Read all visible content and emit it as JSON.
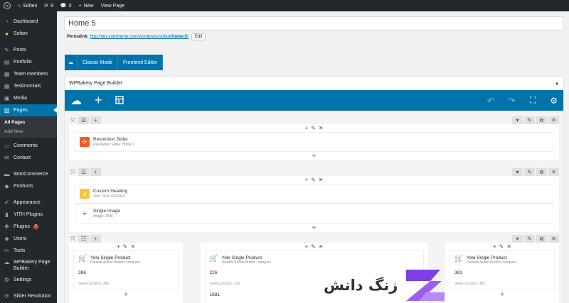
{
  "adminbar": {
    "site": "Sofani",
    "updates": "9",
    "comments": "0",
    "new": "New",
    "view": "View Page"
  },
  "sidebar": {
    "items": [
      {
        "label": "Dashboard",
        "icon": "dashboard-icon"
      },
      {
        "label": "Sofani",
        "icon": "yolo-icon"
      },
      {
        "label": "Posts",
        "icon": "pin-icon"
      },
      {
        "label": "Portfolio",
        "icon": "portfolio-icon"
      },
      {
        "label": "Team members",
        "icon": "team-icon"
      },
      {
        "label": "Testimonials",
        "icon": "testimonials-icon"
      },
      {
        "label": "Media",
        "icon": "media-icon"
      },
      {
        "label": "Pages",
        "icon": "pages-icon"
      }
    ],
    "pages_sub": [
      "All Pages",
      "Add New"
    ],
    "items2": [
      {
        "label": "Comments",
        "icon": "comments-icon"
      },
      {
        "label": "Contact",
        "icon": "mail-icon"
      },
      {
        "label": "WooCommerce",
        "icon": "woo-icon"
      },
      {
        "label": "Products",
        "icon": "products-icon"
      },
      {
        "label": "Appearance",
        "icon": "appearance-icon"
      },
      {
        "label": "YITH Plugins",
        "icon": "yith-icon"
      },
      {
        "label": "Plugins",
        "icon": "plugins-icon",
        "badge": "7"
      },
      {
        "label": "Users",
        "icon": "users-icon"
      },
      {
        "label": "Tools",
        "icon": "tools-icon"
      },
      {
        "label": "WPBakery Page Builder",
        "icon": "wpbakery-icon"
      },
      {
        "label": "Settings",
        "icon": "settings-icon"
      },
      {
        "label": "Slider Revolution",
        "icon": "slider-icon"
      }
    ]
  },
  "editor": {
    "title": "Home 5",
    "permalink_label": "Permalink:",
    "permalink_base": "http://dev.yolotheme.com/wordpress/sofani/",
    "permalink_slug": "home-5",
    "permalink_end": "/",
    "edit_label": "Edit",
    "classic_mode": "Classic Mode",
    "frontend_editor": "Frontend Editor"
  },
  "wpb": {
    "title": "WPBakery Page Builder",
    "rows": [
      {
        "elements": [
          {
            "title": "Revolution Slider",
            "sub": "Revolution Slider: Home 7",
            "icon": "revslider-icon",
            "color": "#ef5b25"
          }
        ]
      },
      {
        "elements": [
          {
            "title": "Custom Heading",
            "sub": "Text: OUR OFFERS",
            "icon": "heading-icon",
            "color": "#f5c542"
          },
          {
            "title": "Single Image",
            "sub": "Image: 1836",
            "icon": "image-icon",
            "color": "#ffffff"
          }
        ]
      },
      {
        "products": [
          {
            "title": "Yolo Single Product",
            "sub": "Disable Action Button: compare",
            "value": "386",
            "select": "Select product: 386"
          },
          {
            "title": "Yolo Single Product",
            "sub": "Disable Action Button: compare",
            "value": "226",
            "select": "Select product: 226",
            "extra": "1881"
          },
          {
            "title": "Yolo Single Product",
            "sub": "Disable Action Button: compare",
            "value": "381",
            "select": "Select product: 381"
          }
        ]
      }
    ]
  },
  "watermark": {
    "text": "زنگ دانش"
  }
}
